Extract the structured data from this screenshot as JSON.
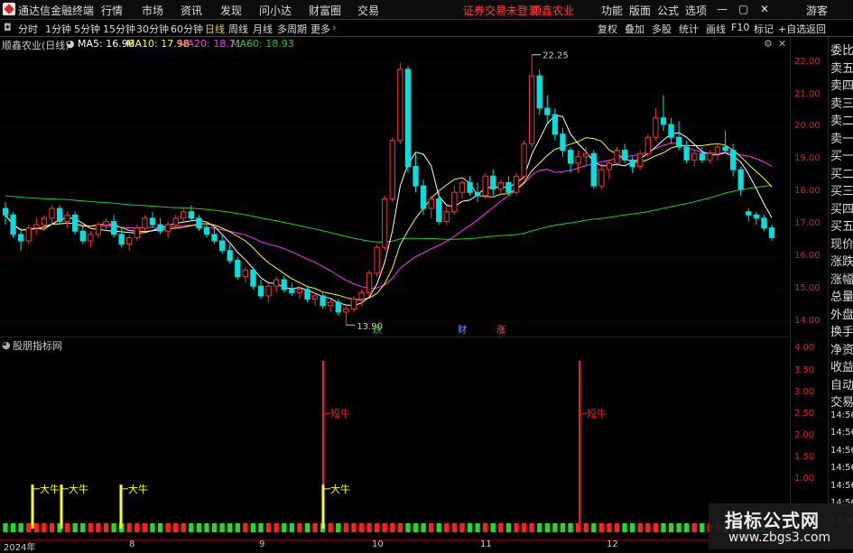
{
  "titlebar": {
    "app_title": "通达信金融终端",
    "menu": [
      "行情",
      "市场",
      "资讯",
      "发现",
      "问小达",
      "财富圈",
      "交易"
    ],
    "warning": "证券交易未登录",
    "stock_name": "顺鑫农业",
    "right_buttons": [
      "功能",
      "版面",
      "公式",
      "选项"
    ],
    "guest": "游客"
  },
  "toolbar": {
    "periods": [
      "分时",
      "1分钟",
      "5分钟",
      "15分钟",
      "30分钟",
      "60分钟",
      "日线",
      "周线",
      "月线",
      "多周期",
      "更多"
    ],
    "active_period": "日线",
    "right_tools": [
      "复权",
      "叠加",
      "多股",
      "统计",
      "画线",
      "F10",
      "标记",
      "+自选",
      "返回"
    ]
  },
  "price_header": {
    "stock": "顺鑫农业(日线)",
    "ma5_label": "MA5: 16.96",
    "ma10_label": "MA10: 17.98",
    "ma20_label": "MA20: 18.71",
    "ma60_label": "MA60: 18.93",
    "colors": {
      "ma5": "#ffffff",
      "ma10": "#ffff00",
      "ma20": "#ff33ff",
      "ma60": "#22cc22"
    }
  },
  "price_marks": {
    "high": "22.25",
    "low": "13.90",
    "tag1": "跌",
    "tag2": "财",
    "tag3": "涨"
  },
  "indicator": {
    "title": "股朋指标网",
    "labels": [
      "大牛",
      "大牛",
      "大牛",
      "短牛",
      "大牛",
      "短牛"
    ]
  },
  "axis_price": [
    "22.00",
    "21.00",
    "20.00",
    "19.00",
    "18.00",
    "17.00",
    "16.00",
    "15.00",
    "14.00"
  ],
  "axis_ind": [
    "4.00",
    "3.50",
    "3.00",
    "2.50",
    "2.00",
    "1.50",
    "1.00"
  ],
  "side_labels": [
    "委比",
    "卖五",
    "卖四",
    "卖三",
    "卖二",
    "卖一",
    "买一",
    "买二",
    "买三",
    "买四",
    "买五",
    "现价",
    "涨跌",
    "涨幅",
    "总量",
    "外盘",
    "换手",
    "净资",
    "收益",
    "自动",
    "交易",
    "14:56",
    "14:56",
    "14:56",
    "14:56",
    "14:56",
    "14:56",
    "14:56"
  ],
  "dates": [
    "2024年",
    "8",
    "9",
    "10",
    "11",
    "12"
  ],
  "watermark": {
    "title": "指标公式网",
    "url": "www.zbgs3.com"
  },
  "chart_data": {
    "type": "candlestick",
    "title": "顺鑫农业(日线)",
    "ylim": [
      13.6,
      22.8
    ],
    "candles": [
      [
        17.5,
        17.7,
        17.0,
        17.3
      ],
      [
        17.3,
        17.4,
        16.6,
        16.7
      ],
      [
        16.7,
        16.9,
        16.2,
        16.5
      ],
      [
        16.5,
        17.0,
        16.4,
        16.9
      ],
      [
        16.9,
        17.2,
        16.7,
        17.0
      ],
      [
        17.0,
        17.3,
        16.8,
        17.2
      ],
      [
        17.2,
        17.6,
        17.0,
        17.5
      ],
      [
        17.5,
        17.6,
        17.0,
        17.1
      ],
      [
        17.1,
        17.4,
        16.9,
        17.3
      ],
      [
        17.3,
        17.4,
        16.7,
        16.8
      ],
      [
        16.8,
        17.0,
        16.4,
        16.5
      ],
      [
        16.5,
        16.8,
        16.3,
        16.7
      ],
      [
        16.7,
        17.1,
        16.6,
        17.0
      ],
      [
        17.0,
        17.2,
        16.8,
        17.1
      ],
      [
        17.1,
        17.3,
        16.6,
        16.7
      ],
      [
        16.7,
        16.9,
        16.3,
        16.4
      ],
      [
        16.4,
        16.7,
        16.2,
        16.6
      ],
      [
        16.6,
        17.0,
        16.5,
        16.9
      ],
      [
        16.9,
        17.3,
        16.8,
        17.2
      ],
      [
        17.2,
        17.4,
        16.9,
        17.0
      ],
      [
        17.0,
        17.2,
        16.7,
        16.8
      ],
      [
        16.8,
        17.1,
        16.6,
        17.0
      ],
      [
        17.0,
        17.3,
        16.9,
        17.2
      ],
      [
        17.2,
        17.5,
        17.1,
        17.4
      ],
      [
        17.4,
        17.6,
        17.1,
        17.2
      ],
      [
        17.2,
        17.3,
        16.8,
        16.9
      ],
      [
        16.9,
        17.0,
        16.6,
        16.7
      ],
      [
        16.7,
        16.9,
        16.4,
        16.5
      ],
      [
        16.5,
        16.7,
        16.1,
        16.2
      ],
      [
        16.2,
        16.4,
        15.8,
        15.9
      ],
      [
        15.9,
        16.0,
        15.3,
        15.4
      ],
      [
        15.4,
        15.7,
        15.2,
        15.6
      ],
      [
        15.6,
        15.7,
        15.0,
        15.1
      ],
      [
        15.1,
        15.3,
        14.7,
        14.8
      ],
      [
        14.8,
        15.2,
        14.6,
        15.1
      ],
      [
        15.1,
        15.4,
        14.9,
        15.3
      ],
      [
        15.3,
        15.4,
        14.9,
        15.0
      ],
      [
        15.0,
        15.2,
        14.8,
        14.9
      ],
      [
        14.9,
        15.1,
        14.7,
        15.0
      ],
      [
        15.0,
        15.1,
        14.6,
        14.7
      ],
      [
        14.7,
        14.9,
        14.5,
        14.8
      ],
      [
        14.8,
        14.9,
        14.4,
        14.5
      ],
      [
        14.5,
        14.7,
        14.3,
        14.6
      ],
      [
        14.6,
        14.7,
        14.2,
        14.3
      ],
      [
        14.3,
        14.5,
        13.9,
        14.4
      ],
      [
        14.4,
        14.8,
        14.3,
        14.7
      ],
      [
        14.7,
        15.0,
        14.5,
        14.9
      ],
      [
        14.9,
        15.6,
        14.8,
        15.5
      ],
      [
        15.5,
        16.4,
        15.4,
        16.3
      ],
      [
        16.3,
        17.9,
        16.2,
        17.8
      ],
      [
        17.8,
        19.7,
        17.7,
        19.6
      ],
      [
        19.6,
        22.0,
        19.5,
        21.8
      ],
      [
        21.8,
        21.9,
        18.6,
        18.8
      ],
      [
        18.8,
        19.2,
        18.0,
        18.2
      ],
      [
        18.2,
        18.4,
        17.3,
        17.5
      ],
      [
        17.5,
        17.9,
        17.2,
        17.8
      ],
      [
        17.8,
        18.0,
        17.0,
        17.1
      ],
      [
        17.1,
        17.6,
        17.0,
        17.4
      ],
      [
        17.4,
        18.2,
        17.3,
        18.0
      ],
      [
        18.0,
        18.4,
        17.8,
        18.3
      ],
      [
        18.3,
        18.5,
        17.9,
        18.0
      ],
      [
        18.0,
        18.3,
        17.7,
        17.9
      ],
      [
        17.9,
        18.6,
        17.8,
        18.5
      ],
      [
        18.5,
        18.7,
        17.9,
        18.1
      ],
      [
        18.1,
        18.4,
        17.9,
        18.3
      ],
      [
        18.3,
        18.5,
        17.9,
        18.0
      ],
      [
        18.0,
        18.6,
        17.9,
        18.5
      ],
      [
        18.5,
        19.6,
        18.4,
        19.5
      ],
      [
        19.5,
        22.25,
        19.4,
        21.6
      ],
      [
        21.6,
        21.8,
        20.4,
        20.6
      ],
      [
        20.6,
        21.0,
        20.1,
        20.4
      ],
      [
        20.4,
        20.6,
        19.6,
        19.8
      ],
      [
        19.8,
        20.0,
        19.1,
        19.3
      ],
      [
        19.3,
        19.4,
        18.6,
        18.9
      ],
      [
        18.9,
        19.3,
        18.6,
        19.1
      ],
      [
        19.1,
        19.4,
        18.8,
        19.2
      ],
      [
        19.2,
        19.3,
        18.1,
        18.2
      ],
      [
        18.2,
        18.9,
        18.1,
        18.7
      ],
      [
        18.7,
        19.0,
        18.4,
        18.9
      ],
      [
        18.9,
        19.4,
        18.8,
        19.3
      ],
      [
        19.3,
        19.5,
        18.9,
        19.0
      ],
      [
        19.0,
        19.1,
        18.6,
        18.8
      ],
      [
        18.8,
        19.3,
        18.7,
        19.2
      ],
      [
        19.2,
        19.8,
        19.1,
        19.7
      ],
      [
        19.7,
        20.6,
        19.6,
        20.3
      ],
      [
        20.3,
        21.0,
        19.9,
        20.1
      ],
      [
        20.1,
        20.3,
        19.5,
        19.7
      ],
      [
        19.7,
        20.2,
        19.3,
        19.4
      ],
      [
        19.4,
        19.6,
        18.9,
        19.0
      ],
      [
        19.0,
        19.3,
        18.8,
        19.2
      ],
      [
        19.2,
        19.4,
        18.9,
        19.0
      ],
      [
        19.0,
        19.3,
        18.9,
        19.2
      ],
      [
        19.2,
        19.5,
        19.0,
        19.4
      ],
      [
        19.4,
        19.9,
        19.2,
        19.3
      ],
      [
        19.3,
        19.5,
        18.5,
        18.7
      ],
      [
        18.7,
        18.8,
        17.9,
        18.1
      ],
      [
        17.4,
        17.5,
        17.1,
        17.3
      ],
      [
        17.3,
        17.4,
        17.0,
        17.2
      ],
      [
        17.2,
        17.3,
        16.8,
        16.9
      ],
      [
        16.9,
        17.0,
        16.5,
        16.6
      ]
    ],
    "ma60_visible": "MA60"
  }
}
